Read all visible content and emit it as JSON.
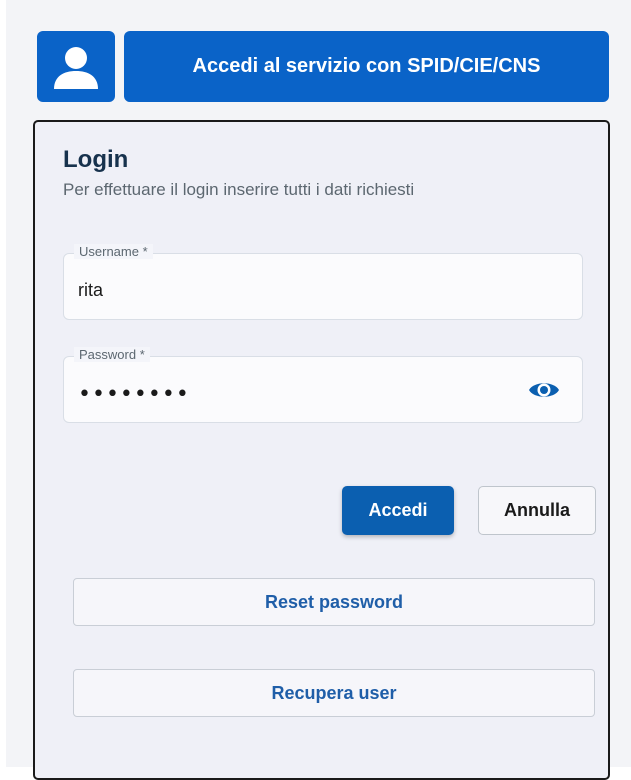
{
  "spid": {
    "button_label": "Accedi al servizio con SPID/CIE/CNS",
    "icon": "user-icon"
  },
  "login": {
    "title": "Login",
    "subtitle": "Per effettuare il login inserire tutti i dati richiesti",
    "username": {
      "label": "Username *",
      "value": "rita"
    },
    "password": {
      "label": "Password *",
      "masked_value": "••••••••",
      "toggle_icon": "eye-icon"
    },
    "submit_label": "Accedi",
    "cancel_label": "Annulla",
    "reset_password_label": "Reset password",
    "recover_user_label": "Recupera user"
  },
  "colors": {
    "primary": "#0a63c8",
    "link": "#1f5ea8"
  }
}
